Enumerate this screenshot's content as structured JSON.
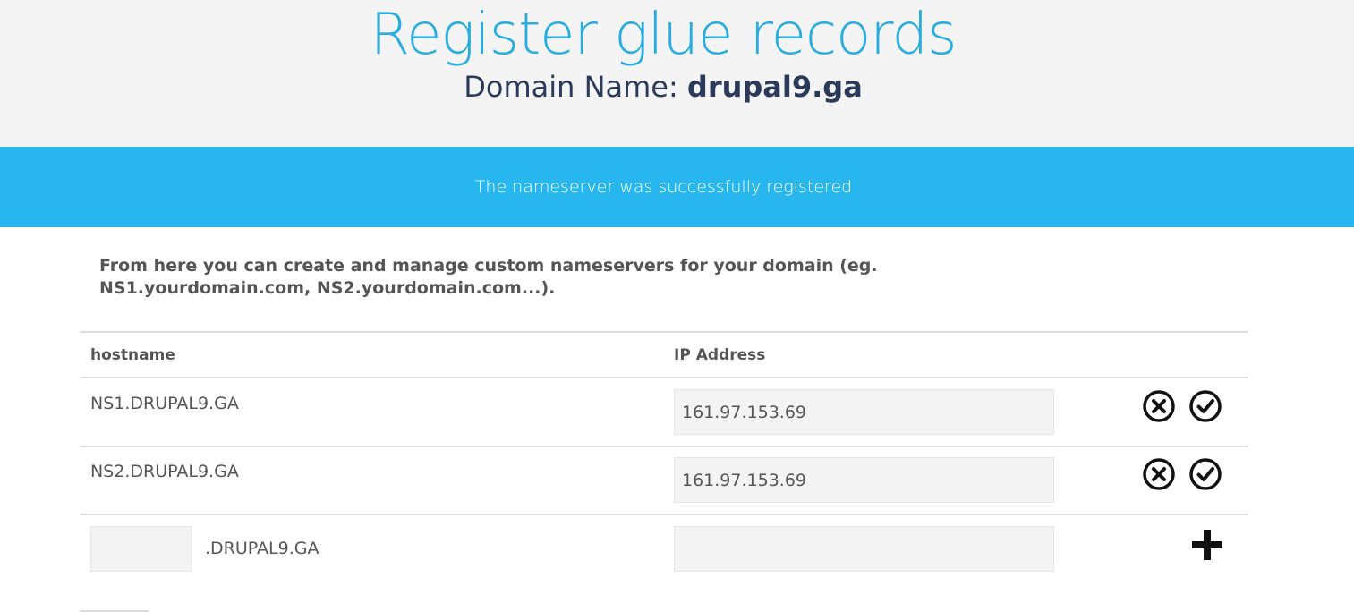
{
  "header": {
    "title": "Register glue records",
    "domain_label": "Domain Name:",
    "domain_value": "drupal9.ga"
  },
  "alert": {
    "message": "The nameserver was successfully registered",
    "color": "#27b7ee"
  },
  "intro": {
    "text": "From here you can create and manage custom nameservers for your domain (eg. NS1.yourdomain.com, NS2.yourdomain.com...)."
  },
  "table": {
    "headers": {
      "hostname": "hostname",
      "ip": "IP Address"
    },
    "rows": [
      {
        "hostname": "NS1.DRUPAL9.GA",
        "ip": "161.97.153.69"
      },
      {
        "hostname": "NS2.DRUPAL9.GA",
        "ip": "161.97.153.69"
      }
    ],
    "new_row": {
      "suffix": ".DRUPAL9.GA",
      "host_value": "",
      "ip_value": ""
    }
  },
  "icons": {
    "delete": "circle-x-icon",
    "save": "circle-check-icon",
    "add": "plus-icon"
  },
  "colors": {
    "title": "#29ace0",
    "header_bg": "#f4f4f4",
    "text": "#555555"
  }
}
